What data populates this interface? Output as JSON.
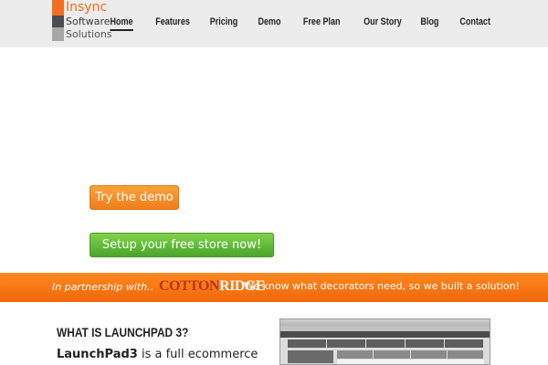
{
  "header": {
    "logo": {
      "line1": "Insync",
      "line2": "Software",
      "line3": "Solutions"
    },
    "nav": [
      "Home",
      "Features",
      "Pricing",
      "Demo",
      "Free Plan",
      "Our Story",
      "Blog",
      "Contact"
    ],
    "active_nav": "Home"
  },
  "hero": {
    "demo_button": "Try the demo",
    "store_button": "Setup your free store now!"
  },
  "banner": {
    "lead": "In partnership with..",
    "partner_part1": "COTTON",
    "partner_part2": "RIDGE",
    "tagline": "We know what decorators need, so we built a solution!"
  },
  "section": {
    "heading": "WHAT IS LAUNCHPAD 3?",
    "product": "LaunchPad3",
    "intro": " is a full ecommerce"
  },
  "colors": {
    "orange": "#f26f21",
    "green": "#4aa42a",
    "banner": "#f0660a"
  }
}
